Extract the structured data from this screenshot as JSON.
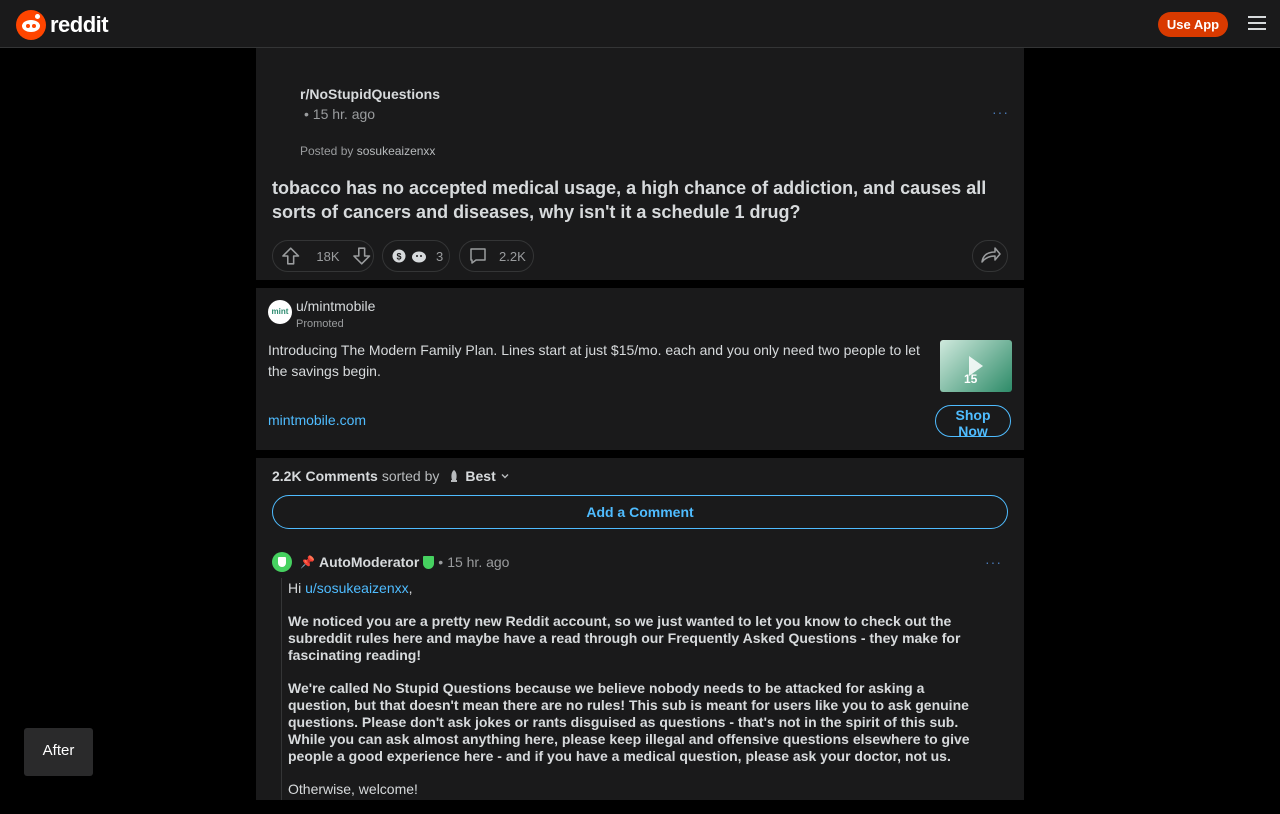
{
  "header": {
    "brand": "reddit",
    "use_app": "Use App"
  },
  "post": {
    "subreddit": "r/NoStupidQuestions",
    "time": "• 15 hr. ago",
    "more": "···",
    "posted_by_prefix": "Posted by",
    "author": "sosukeaizenxx",
    "title": "tobacco has no accepted medical usage, a high chance of addiction, and causes all sorts of cancers and diseases, why isn't it a schedule 1 drug?",
    "votes": "18K",
    "award_count": "3",
    "comments": "2.2K"
  },
  "ad": {
    "user": "u/mintmobile",
    "promoted": "Promoted",
    "avatar_text": "mint",
    "text": "Introducing The Modern Family Plan. Lines start at just $15/mo. each and you only need two people to let the savings begin.",
    "thumb_text": "15",
    "link": "mintmobile.com",
    "cta": "Shop Now"
  },
  "comments": {
    "count": "2.2K Comments",
    "sorted_by": "sorted by",
    "sort_value": "Best",
    "add_comment": "Add a Comment",
    "top": {
      "author": "AutoModerator",
      "time": "15 hr. ago",
      "greeting_prefix": "Hi",
      "greeting_user": "u/sosukeaizenxx",
      "greeting_suffix": ",",
      "para1": "We noticed you are a pretty new Reddit account, so we just wanted to let you know to check out the subreddit rules here and maybe have a read through our Frequently Asked Questions - they make for fascinating reading!",
      "para2": "We're called No Stupid Questions because we believe nobody needs to be attacked for asking a question, but that doesn't mean there are no rules! This sub is meant for users like you to ask genuine questions. Please don't ask jokes or rants disguised as questions - that's not in the spirit of this sub. While you can ask almost anything here, please keep illegal and offensive questions elsewhere to give people a good experience here - and if you have a medical question, please ask your doctor, not us.",
      "para3": "Otherwise, welcome!"
    }
  },
  "after_label": "After"
}
